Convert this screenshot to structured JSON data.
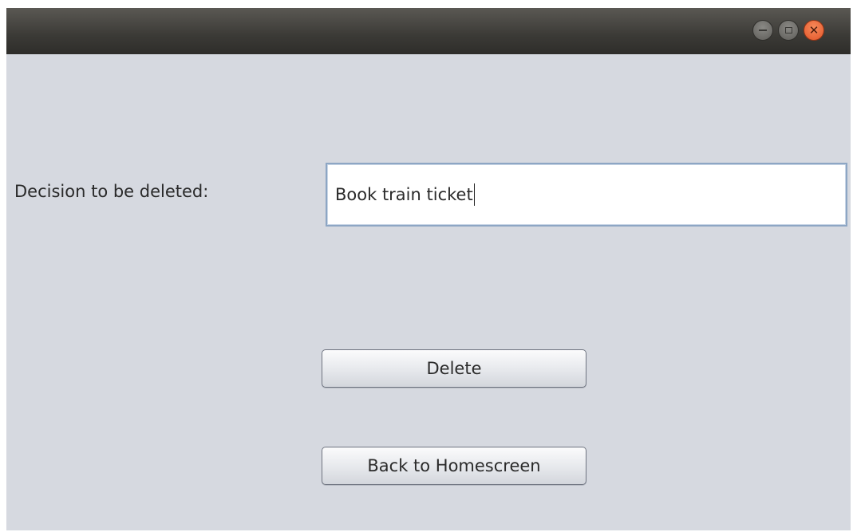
{
  "window": {
    "controls": {
      "minimize_icon": "minimize-icon",
      "maximize_icon": "maximize-icon",
      "close_icon": "close-icon",
      "close_color": "#e95420"
    }
  },
  "form": {
    "label": "Decision to be deleted:",
    "input_value": "Book train ticket"
  },
  "buttons": {
    "delete_label": "Delete",
    "back_label": "Back to Homescreen"
  }
}
